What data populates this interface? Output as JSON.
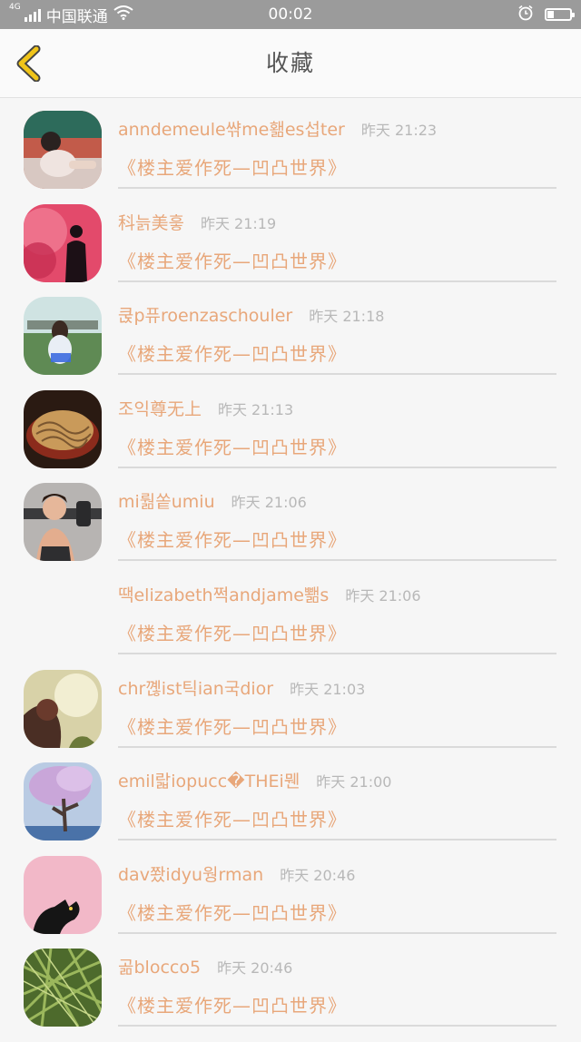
{
  "status_bar": {
    "network_tag": "4G",
    "carrier": "中国联通",
    "time": "00:02",
    "battery_level": 0.28,
    "icons": [
      "signal-icon",
      "wifi-icon",
      "alarm-icon",
      "battery-icon"
    ]
  },
  "nav": {
    "title": "收藏",
    "back_icon": "chevron-left-icon",
    "back_color": "#f0c419"
  },
  "colors": {
    "accent": "#e8a77a",
    "time_text": "#b8b8b8",
    "divider": "#dadada"
  },
  "favorites": [
    {
      "user": "anndemeule쌲me홺es섭ter",
      "time": "昨天 21:23",
      "post": "《楼主爱作死—凹凸世界》",
      "avatar": "girl-on-track-photo"
    },
    {
      "user": "科늙美흫",
      "time": "昨天 21:19",
      "post": "《楼主爱作死—凹凸世界》",
      "avatar": "pink-smoke-photo"
    },
    {
      "user": "쿥p퓨roenzaschouler",
      "time": "昨天 21:18",
      "post": "《楼主爱作死—凹凸世界》",
      "avatar": "girl-on-grass-photo"
    },
    {
      "user": "조익尊无上",
      "time": "昨天 21:13",
      "post": "《楼主爱作死—凹凸世界》",
      "avatar": "noodles-photo"
    },
    {
      "user": "mi뤎쏱umiu",
      "time": "昨天 21:06",
      "post": "《楼主爱作死—凹凸世界》",
      "avatar": "woman-dumbbell-photo"
    },
    {
      "user": "땍elizabeth쩍andjame뾂s",
      "time": "昨天 21:06",
      "post": "《楼主爱作死—凹凸世界》",
      "avatar": ""
    },
    {
      "user": "chr꼖ist틱ian국dior",
      "time": "昨天 21:03",
      "post": "《楼主爱作死—凹凸世界》",
      "avatar": "sunset-girl-photo"
    },
    {
      "user": "emil랇iopucc�THEi뭰",
      "time": "昨天 21:00",
      "post": "《楼主爱作死—凹凸世界》",
      "avatar": "blossom-tree-photo"
    },
    {
      "user": "dav쫬idyu웡rman",
      "time": "昨天 20:46",
      "post": "《楼主爱作死—凹凸世界》",
      "avatar": "black-cat-pink-photo"
    },
    {
      "user": "곪blocco5",
      "time": "昨天 20:46",
      "post": "《楼主爱作死—凹凸世界》",
      "avatar": "green-grass-photo"
    }
  ]
}
